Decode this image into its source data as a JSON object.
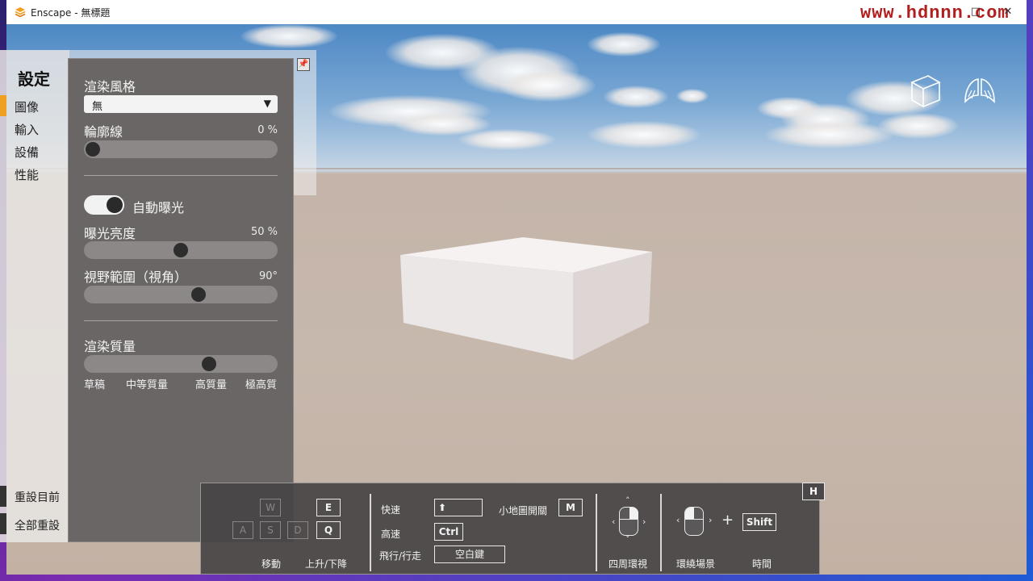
{
  "window": {
    "title": "Enscape - 無標題",
    "watermark": "www.hdnnn.com",
    "minimize": "—",
    "maximize": "□",
    "close": "✕"
  },
  "nav": {
    "title": "設定",
    "items": [
      {
        "label": "圖像",
        "active": true
      },
      {
        "label": "輸入",
        "active": false
      },
      {
        "label": "設備",
        "active": false
      },
      {
        "label": "性能",
        "active": false
      }
    ],
    "reset_current": "重設目前",
    "reset_all": "全部重設"
  },
  "panel": {
    "render_style_label": "渲染風格",
    "render_style_value": "無",
    "outline_label": "輪廓線",
    "outline_value": "0 %",
    "outline_level": 0,
    "auto_exposure_label": "自動曝光",
    "auto_exposure_on": true,
    "exposure_label": "曝光亮度",
    "exposure_value": "50 %",
    "exposure_level": 0.5,
    "fov_label": "視野範圍（視角）",
    "fov_value": "90°",
    "fov_level": 0.6,
    "quality_label": "渲染質量",
    "quality_level": 0.66,
    "quality_ticks": [
      "草稿",
      "中等質量",
      "高質量",
      "極高質"
    ]
  },
  "controls": {
    "keys": {
      "w": "W",
      "a": "A",
      "s": "S",
      "d": "D",
      "e": "E",
      "q": "Q",
      "shift_arrow": "⬆",
      "ctrl": "Ctrl",
      "space": "空白鍵",
      "m": "M",
      "shift": "Shift",
      "h": "H"
    },
    "move": "移動",
    "up_down": "上升/下降",
    "fast": "快速",
    "faster": "高速",
    "fly_walk": "飛行/行走",
    "minimap": "小地圖開關",
    "look_around": "四周環視",
    "orbit": "環繞場景",
    "plus": "+",
    "time": "時間"
  },
  "icons": {
    "title": "enscape-logo-icon",
    "view_cube": "view-cube-icon",
    "fly_mode": "wings-icon",
    "pin": "pin-icon",
    "dropdown": "chevron-down-icon"
  },
  "colors": {
    "accent": "#f0a020",
    "panel_bg": "#6a6665",
    "watermark": "#b21e1e"
  }
}
